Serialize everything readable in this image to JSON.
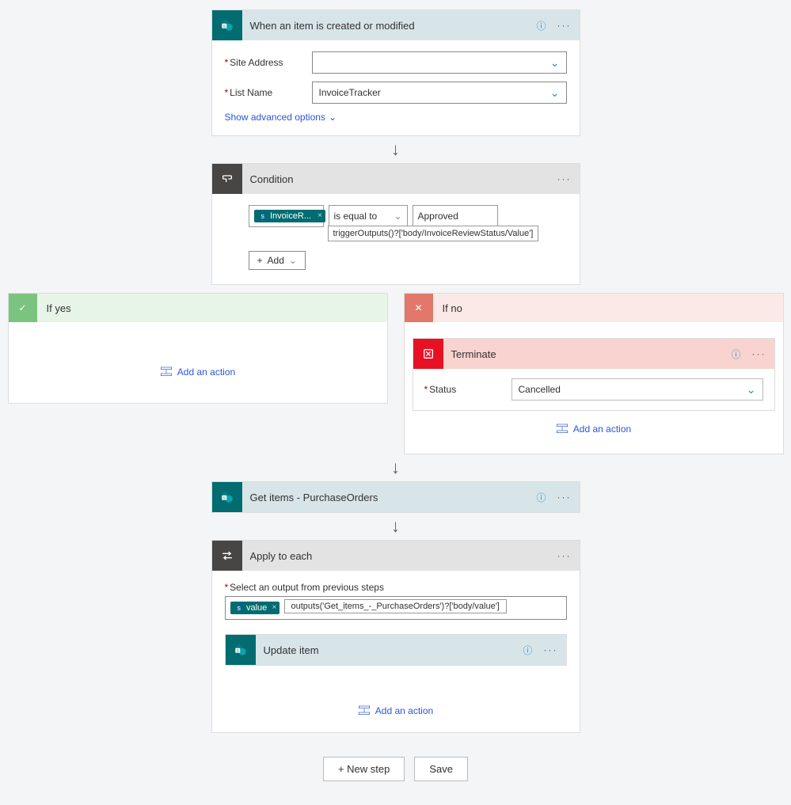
{
  "trigger": {
    "title": "When an item is created or modified",
    "site_label": "Site Address",
    "site_value": "",
    "list_label": "List Name",
    "list_value": "InvoiceTracker",
    "advanced": "Show advanced options"
  },
  "condition": {
    "title": "Condition",
    "token": "InvoiceR...",
    "operator": "is equal to",
    "value": "Approved",
    "tooltip": "triggerOutputs()?['body/InvoiceReviewStatus/Value']",
    "add": "Add"
  },
  "branches": {
    "yes_title": "If yes",
    "no_title": "If no",
    "add_action": "Add an action"
  },
  "terminate": {
    "title": "Terminate",
    "status_label": "Status",
    "status_value": "Cancelled"
  },
  "getitems": {
    "title": "Get items - PurchaseOrders"
  },
  "apply": {
    "title": "Apply to each",
    "select_label": "Select an output from previous steps",
    "token": "value",
    "expr": "outputs('Get_items_-_PurchaseOrders')?['body/value']"
  },
  "update": {
    "title": "Update item"
  },
  "footer": {
    "newstep": "+ New step",
    "save": "Save"
  }
}
